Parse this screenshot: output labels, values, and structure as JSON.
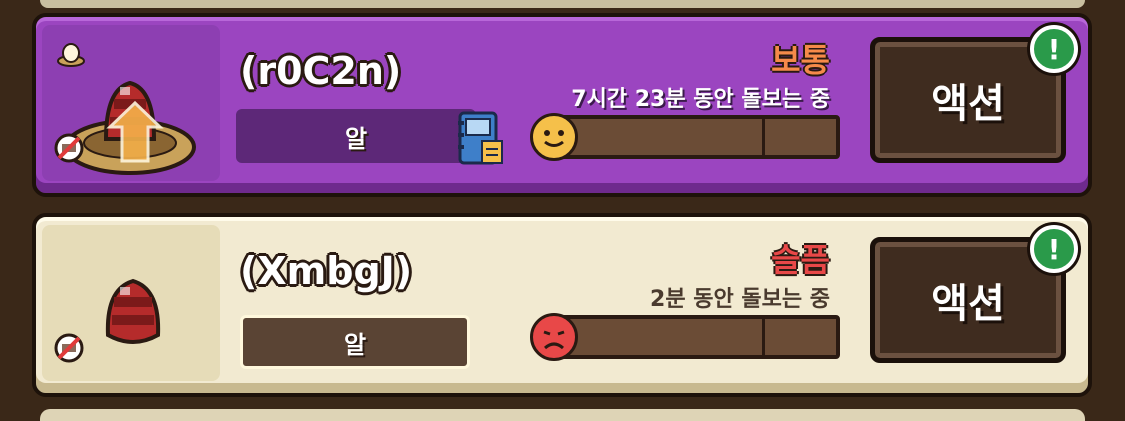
{
  "colors": {
    "card1_bg": "#9b45c0",
    "card2_bg": "#f2ead1",
    "mood_normal": "#f58a4a",
    "mood_sad": "#e84848",
    "alert_green": "#2a9a4a",
    "progress_orange": "#f0882e"
  },
  "pets": [
    {
      "name": "(r0C2n)",
      "type_label": "알",
      "mood_label": "보통",
      "care_text": "7시간 23분 동안 돌보는 중",
      "mood_level": 0.05,
      "face_icon": "happy-face-icon",
      "action_label": "액션",
      "alert_symbol": "!",
      "has_book_icon": true
    },
    {
      "name": "(XmbgJ)",
      "type_label": "알",
      "mood_label": "슬픔",
      "care_text": "2분 동안 돌보는 중",
      "mood_level": 0.0,
      "face_icon": "sad-face-icon",
      "action_label": "액션",
      "alert_symbol": "!",
      "has_book_icon": false
    }
  ]
}
